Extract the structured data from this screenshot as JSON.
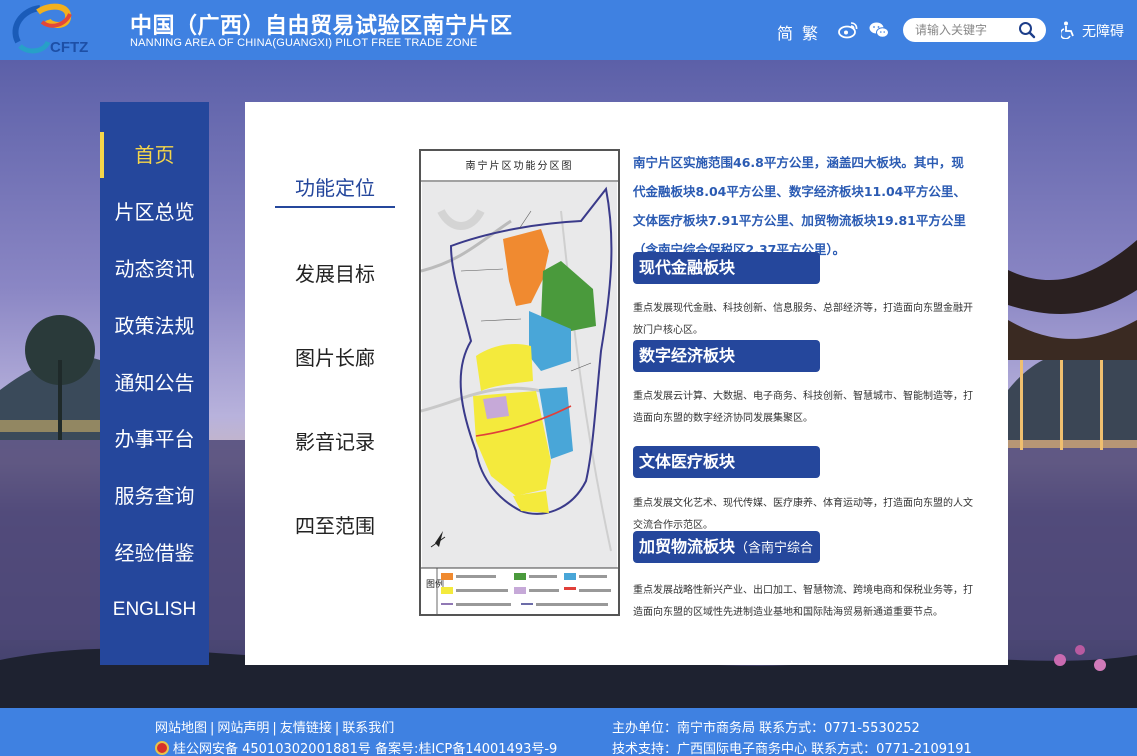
{
  "header": {
    "title": "中国（广西）自由贸易试验区南宁片区",
    "subtitle": "NANNING AREA OF CHINA(GUANGXI) PILOT FREE TRADE ZONE",
    "logo_text": "CFTZ",
    "lang_simplified": "简",
    "lang_traditional": "繁",
    "search_placeholder": "请输入关键字",
    "accessibility_label": "无障碍",
    "icons": [
      "weibo-icon",
      "wechat-icon",
      "search-icon",
      "accessibility-icon"
    ]
  },
  "sidenav": {
    "items": [
      {
        "label": "首页",
        "active": true
      },
      {
        "label": "片区总览"
      },
      {
        "label": "动态资讯"
      },
      {
        "label": "政策法规"
      },
      {
        "label": "通知公告"
      },
      {
        "label": "办事平台"
      },
      {
        "label": "服务查询"
      },
      {
        "label": "经验借鉴"
      },
      {
        "label": "ENGLISH"
      }
    ]
  },
  "subnav": {
    "items": [
      {
        "label": "功能定位",
        "active": true
      },
      {
        "label": "发展目标"
      },
      {
        "label": "图片长廊"
      },
      {
        "label": "影音记录"
      },
      {
        "label": "四至范围"
      }
    ]
  },
  "map": {
    "title": "南宁片区功能分区图",
    "legend_label": "图例",
    "colors": {
      "finance": "#f08a30",
      "culture": "#4a9a3c",
      "digital": "#49a6d8",
      "logistics": "#f4ea3c",
      "bonded": "#c6a9d8",
      "boundary": "#6a4a9a",
      "red_line": "#e0403a"
    }
  },
  "intro": "南宁片区实施范围46.8平方公里，涵盖四大板块。其中，现代金融板块8.04平方公里、数字经济板块11.04平方公里、文体医疗板块7.91平方公里、加贸物流板块19.81平方公里（含南宁综合保税区2.37平方公里）。",
  "blocks": [
    {
      "title": "现代金融板块",
      "sub": "",
      "desc": "重点发展现代金融、科技创新、信息服务、总部经济等，打造面向东盟金融开放门户核心区。"
    },
    {
      "title": "数字经济板块",
      "sub": "",
      "desc": "重点发展云计算、大数据、电子商务、科技创新、智慧城市、智能制造等，打造面向东盟的数字经济协同发展集聚区。"
    },
    {
      "title": "文体医疗板块",
      "sub": "",
      "desc": "重点发展文化艺术、现代传媒、医疗康养、体育运动等，打造面向东盟的人文交流合作示范区。"
    },
    {
      "title": "加贸物流板块",
      "sub": "（含南宁综合保税区）",
      "desc": "重点发展战略性新兴产业、出口加工、智慧物流、跨境电商和保税业务等，打造面向东盟的区域性先进制造业基地和国际陆海贸易新通道重要节点。"
    }
  ],
  "footer": {
    "links": [
      "网站地图",
      "网站声明",
      "友情链接",
      "联系我们"
    ],
    "police": "桂公网安备 45010302001881号  备案号:桂ICP备14001493号-9",
    "host": "主办单位：南宁市商务局  联系方式：0771-5530252",
    "tech": "技术支持：广西国际电子商务中心  联系方式：0771-2109191"
  }
}
